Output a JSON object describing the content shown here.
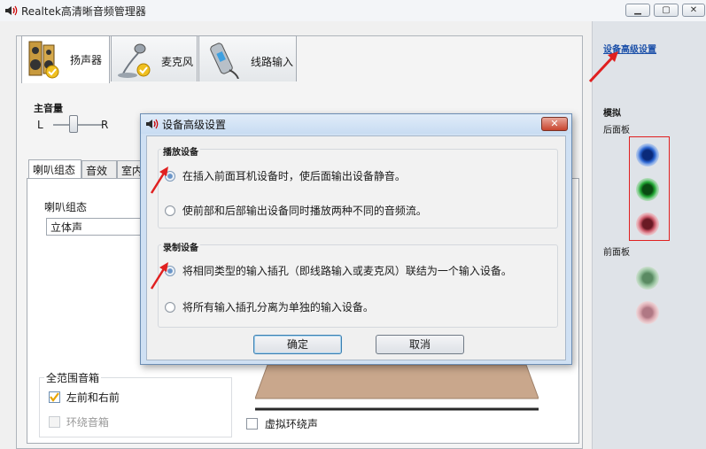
{
  "window": {
    "title": "Realtek高清晰音频管理器",
    "controls": [
      "minimize",
      "maximize",
      "close"
    ]
  },
  "device_tabs": [
    {
      "label": "扬声器",
      "icon": "speaker-icon",
      "active": true
    },
    {
      "label": "麦克风",
      "icon": "microphone-icon",
      "active": false
    },
    {
      "label": "线路输入",
      "icon": "line-in-icon",
      "active": false
    }
  ],
  "volume": {
    "label": "主音量",
    "left": "L",
    "right": "R"
  },
  "config_tabs": [
    {
      "label": "喇叭组态",
      "active": true
    },
    {
      "label": "音效",
      "active": false
    },
    {
      "label": "室内",
      "active": false
    }
  ],
  "speaker_config": {
    "label": "喇叭组态",
    "selected": "立体声"
  },
  "full_range": {
    "title": "全范围音箱",
    "front_lr": {
      "label": "左前和右前",
      "checked": true,
      "enabled": true
    },
    "surround": {
      "label": "环绕音箱",
      "checked": false,
      "enabled": false
    }
  },
  "virtual_surround": {
    "label": "虚拟环绕声",
    "checked": false
  },
  "right_panel": {
    "advanced_link": "设备高级设置",
    "analog_label": "模拟",
    "back_panel_label": "后面板",
    "front_panel_label": "前面板",
    "back_jacks": [
      "#1f4fb8",
      "#1c8a2a",
      "#c45a6a"
    ],
    "front_jacks": [
      "#7fae86",
      "#d8a0a8"
    ]
  },
  "dialog": {
    "title": "设备高级设置",
    "close": "✕",
    "playback": {
      "title": "播放设备",
      "options": [
        {
          "label": "在插入前面耳机设备时，使后面输出设备静音。",
          "selected": true
        },
        {
          "label": "使前部和后部输出设备同时播放两种不同的音频流。",
          "selected": false
        }
      ]
    },
    "record": {
      "title": "录制设备",
      "options": [
        {
          "label": "将相同类型的输入插孔（即线路输入或麦克风）联结为一个输入设备。",
          "selected": true
        },
        {
          "label": "将所有输入插孔分离为单独的输入设备。",
          "selected": false
        }
      ]
    },
    "ok": "确定",
    "cancel": "取消"
  },
  "accent_colors": {
    "annotation": "#e02020",
    "link": "#1a4fa8",
    "dialog_frame": "#cfe0f3"
  }
}
